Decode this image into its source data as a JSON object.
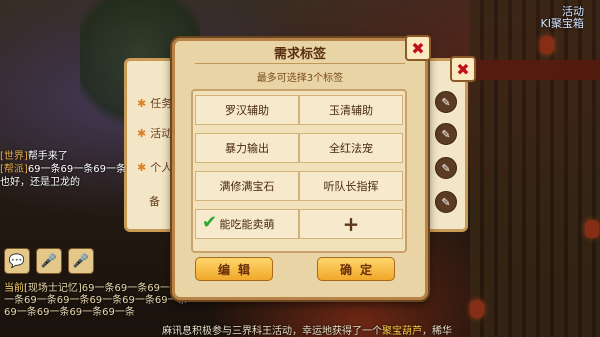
{
  "top_right": {
    "line1": "活动",
    "line2": "KI聚宝箱"
  },
  "back_panel": {
    "rows": [
      "任务",
      "活动",
      "个人",
      "备"
    ]
  },
  "chat": {
    "line1_tag": "[世界]",
    "line1": "帮手来了",
    "line2_tag": "[帮派]",
    "line2": "69一条69一条69一条",
    "line3": "也好，还是卫龙的",
    "icon_labels": [
      "语音",
      "说"
    ]
  },
  "log": {
    "label": "当前",
    "text": "[现场士记忆]69一条69一条69一条69一条69一条69一条69一条69一条69一条69一条69一条69一条69一条"
  },
  "ticker": {
    "text": "麻讯息积极参与三界科王活动，幸运地获得了一个",
    "gold": "聚宝葫芦",
    "end": "，稀华"
  },
  "modal": {
    "title": "需求标签",
    "subtitle": "最多可选择3个标签",
    "tags": [
      "罗汉辅助",
      "玉清辅助",
      "暴力输出",
      "全红法宠",
      "满修满宝石",
      "听队长指挥",
      "能吃能卖萌",
      "+"
    ],
    "checked_index": 6,
    "edit_label": "编辑",
    "confirm_label": "确定"
  },
  "icons": {
    "close": "close-icon",
    "check": "checkmark-icon",
    "edit": "pencil-icon",
    "plus": "plus-icon"
  }
}
